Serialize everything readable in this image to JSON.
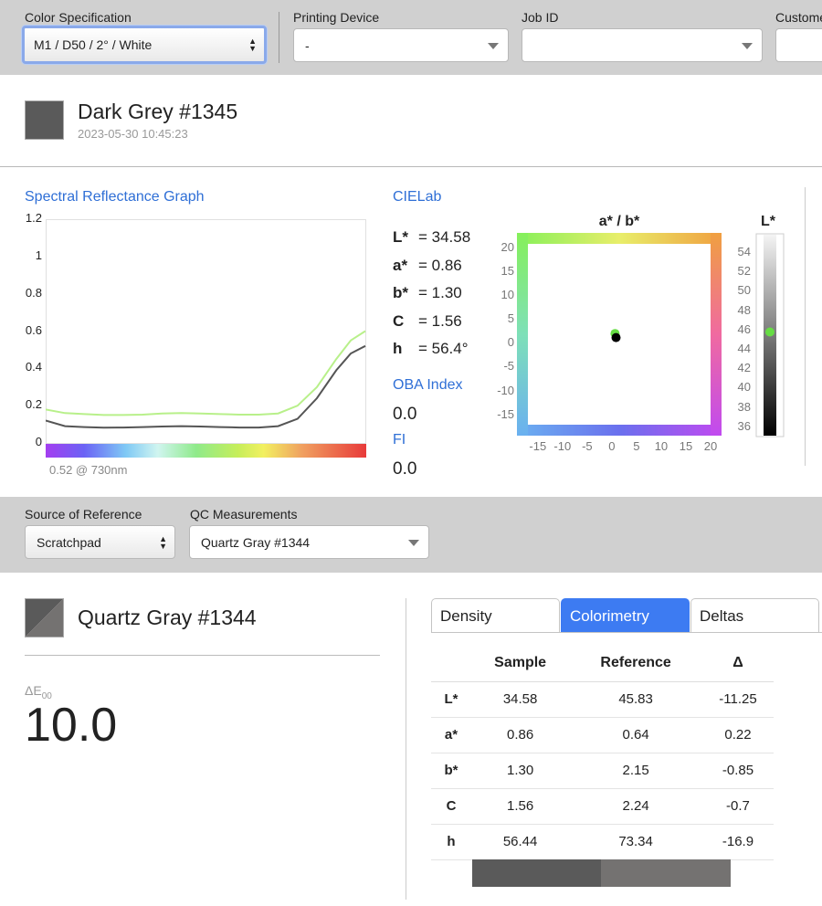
{
  "topbar": {
    "color_spec": {
      "label": "Color Specification",
      "value": "M1 / D50 / 2° / White"
    },
    "printing_device": {
      "label": "Printing Device",
      "value": "-"
    },
    "job_id": {
      "label": "Job ID",
      "value": ""
    },
    "customer": {
      "label": "Custome",
      "value": ""
    }
  },
  "sample": {
    "name": "Dark Grey #1345",
    "timestamp": "2023-05-30 10:45:23",
    "swatch_color": "#5a5a5a"
  },
  "spectral": {
    "title": "Spectral Reflectance Graph",
    "readout": "0.52 @ 730nm",
    "chart_data": {
      "type": "line",
      "title": "Spectral Reflectance Graph",
      "y_ticks": [
        "1.2",
        "1",
        "0.8",
        "0.6",
        "0.4",
        "0.2",
        "0"
      ],
      "ylim": [
        0,
        1.2
      ],
      "xlim": [
        400,
        730
      ],
      "grid": false,
      "series": [
        {
          "color": "#b8f08a",
          "x": [
            400,
            420,
            440,
            460,
            480,
            500,
            520,
            540,
            560,
            580,
            600,
            620,
            640,
            660,
            680,
            700,
            715,
            730
          ],
          "values": [
            0.18,
            0.16,
            0.155,
            0.15,
            0.15,
            0.152,
            0.158,
            0.16,
            0.158,
            0.155,
            0.152,
            0.152,
            0.158,
            0.2,
            0.3,
            0.45,
            0.55,
            0.6
          ]
        },
        {
          "color": "#555555",
          "x": [
            400,
            420,
            440,
            460,
            480,
            500,
            520,
            540,
            560,
            580,
            600,
            620,
            640,
            660,
            680,
            700,
            715,
            730
          ],
          "values": [
            0.12,
            0.09,
            0.085,
            0.082,
            0.083,
            0.085,
            0.088,
            0.09,
            0.088,
            0.085,
            0.083,
            0.083,
            0.09,
            0.13,
            0.24,
            0.39,
            0.48,
            0.52
          ]
        }
      ]
    }
  },
  "cielab": {
    "title": "CIELab",
    "rows": [
      {
        "key": "L*",
        "value": "= 34.58"
      },
      {
        "key": "a*",
        "value": "= 0.86"
      },
      {
        "key": "b*",
        "value": "= 1.30"
      },
      {
        "key": "C",
        "value": "= 1.56"
      },
      {
        "key": "h",
        "value": "= 56.4°"
      }
    ],
    "oba_label": "OBA Index",
    "oba_value": "0.0",
    "fi_label": "FI",
    "fi_value": "0.0"
  },
  "ab_plot": {
    "title": "a* / b*",
    "chart_data": {
      "type": "scatter",
      "title": "a* / b*",
      "x_ticks": [
        "-15",
        "-10",
        "-5",
        "0",
        "5",
        "10",
        "15",
        "20"
      ],
      "y_ticks": [
        "20",
        "15",
        "10",
        "5",
        "0",
        "-5",
        "-10",
        "-15"
      ],
      "xlim": [
        -17,
        20
      ],
      "ylim": [
        -17,
        21
      ],
      "points": [
        {
          "x": 0.64,
          "y": 2.15,
          "color": "#66dd44"
        },
        {
          "x": 0.86,
          "y": 1.3,
          "color": "#000000"
        }
      ]
    }
  },
  "l_plot": {
    "title": "L*",
    "ticks": [
      "54",
      "52",
      "50",
      "48",
      "46",
      "44",
      "42",
      "40",
      "38",
      "36"
    ],
    "range": [
      35.5,
      55.5
    ],
    "marker": {
      "value": 45.83,
      "color": "#66dd44"
    }
  },
  "reference": {
    "source_label": "Source of Reference",
    "source_value": "Scratchpad",
    "qc_label": "QC Measurements",
    "qc_value": "Quartz Gray #1344",
    "name": "Quartz Gray #1344",
    "delta_label": "ΔE",
    "delta_sub": "00",
    "delta_value": "10.0"
  },
  "tabs": [
    "Density",
    "Colorimetry",
    "Deltas"
  ],
  "table": {
    "headers": [
      "",
      "Sample",
      "Reference",
      "Δ"
    ],
    "rows": [
      [
        "L*",
        "34.58",
        "45.83",
        "-11.25"
      ],
      [
        "a*",
        "0.86",
        "0.64",
        "0.22"
      ],
      [
        "b*",
        "1.30",
        "2.15",
        "-0.85"
      ],
      [
        "C",
        "1.56",
        "2.24",
        "-0.7"
      ],
      [
        "h",
        "56.44",
        "73.34",
        "-16.9"
      ]
    ]
  },
  "colors": {
    "sample": "#5a5a5a",
    "reference": "#747271",
    "accent": "#3d7bf2"
  }
}
